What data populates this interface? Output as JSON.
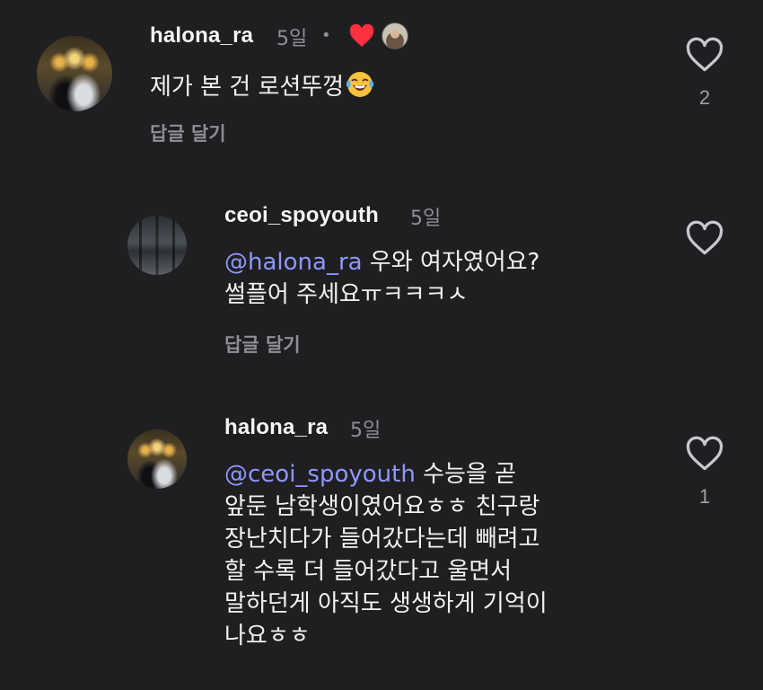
{
  "comments": [
    {
      "username": "halona_ra",
      "time": "5일",
      "dot": "•",
      "text": "제가 본 건 로션뚜껑",
      "emoji": "face-with-tears-of-joy",
      "reply_label": "답글 달기",
      "like_count": "2",
      "liked_by_author": true
    },
    {
      "username": "ceoi_spoyouth",
      "time": "5일",
      "mention": "@halona_ra",
      "text_line1": " 우와 여자였어요?",
      "text_line2": "썰플어 주세요ㅠㅋㅋㅋㅅ",
      "reply_label": "답글 달기",
      "like_count": ""
    },
    {
      "username": "halona_ra",
      "time": "5일",
      "mention": "@ceoi_spoyouth",
      "lines": [
        " 수능을 곧",
        "앞둔 남학생이였어요ㅎㅎ 친구랑",
        "장난치다가 들어갔다는데 빼려고",
        "할 수록 더 들어갔다고 울면서",
        "말하던게 아직도 생생하게 기억이",
        "나요ㅎㅎ"
      ],
      "like_count": "1"
    }
  ],
  "colors": {
    "background": "#1f1f21",
    "mention": "#8e98ff",
    "heart_red": "#ff3040",
    "secondary_text": "#8e8e93"
  }
}
